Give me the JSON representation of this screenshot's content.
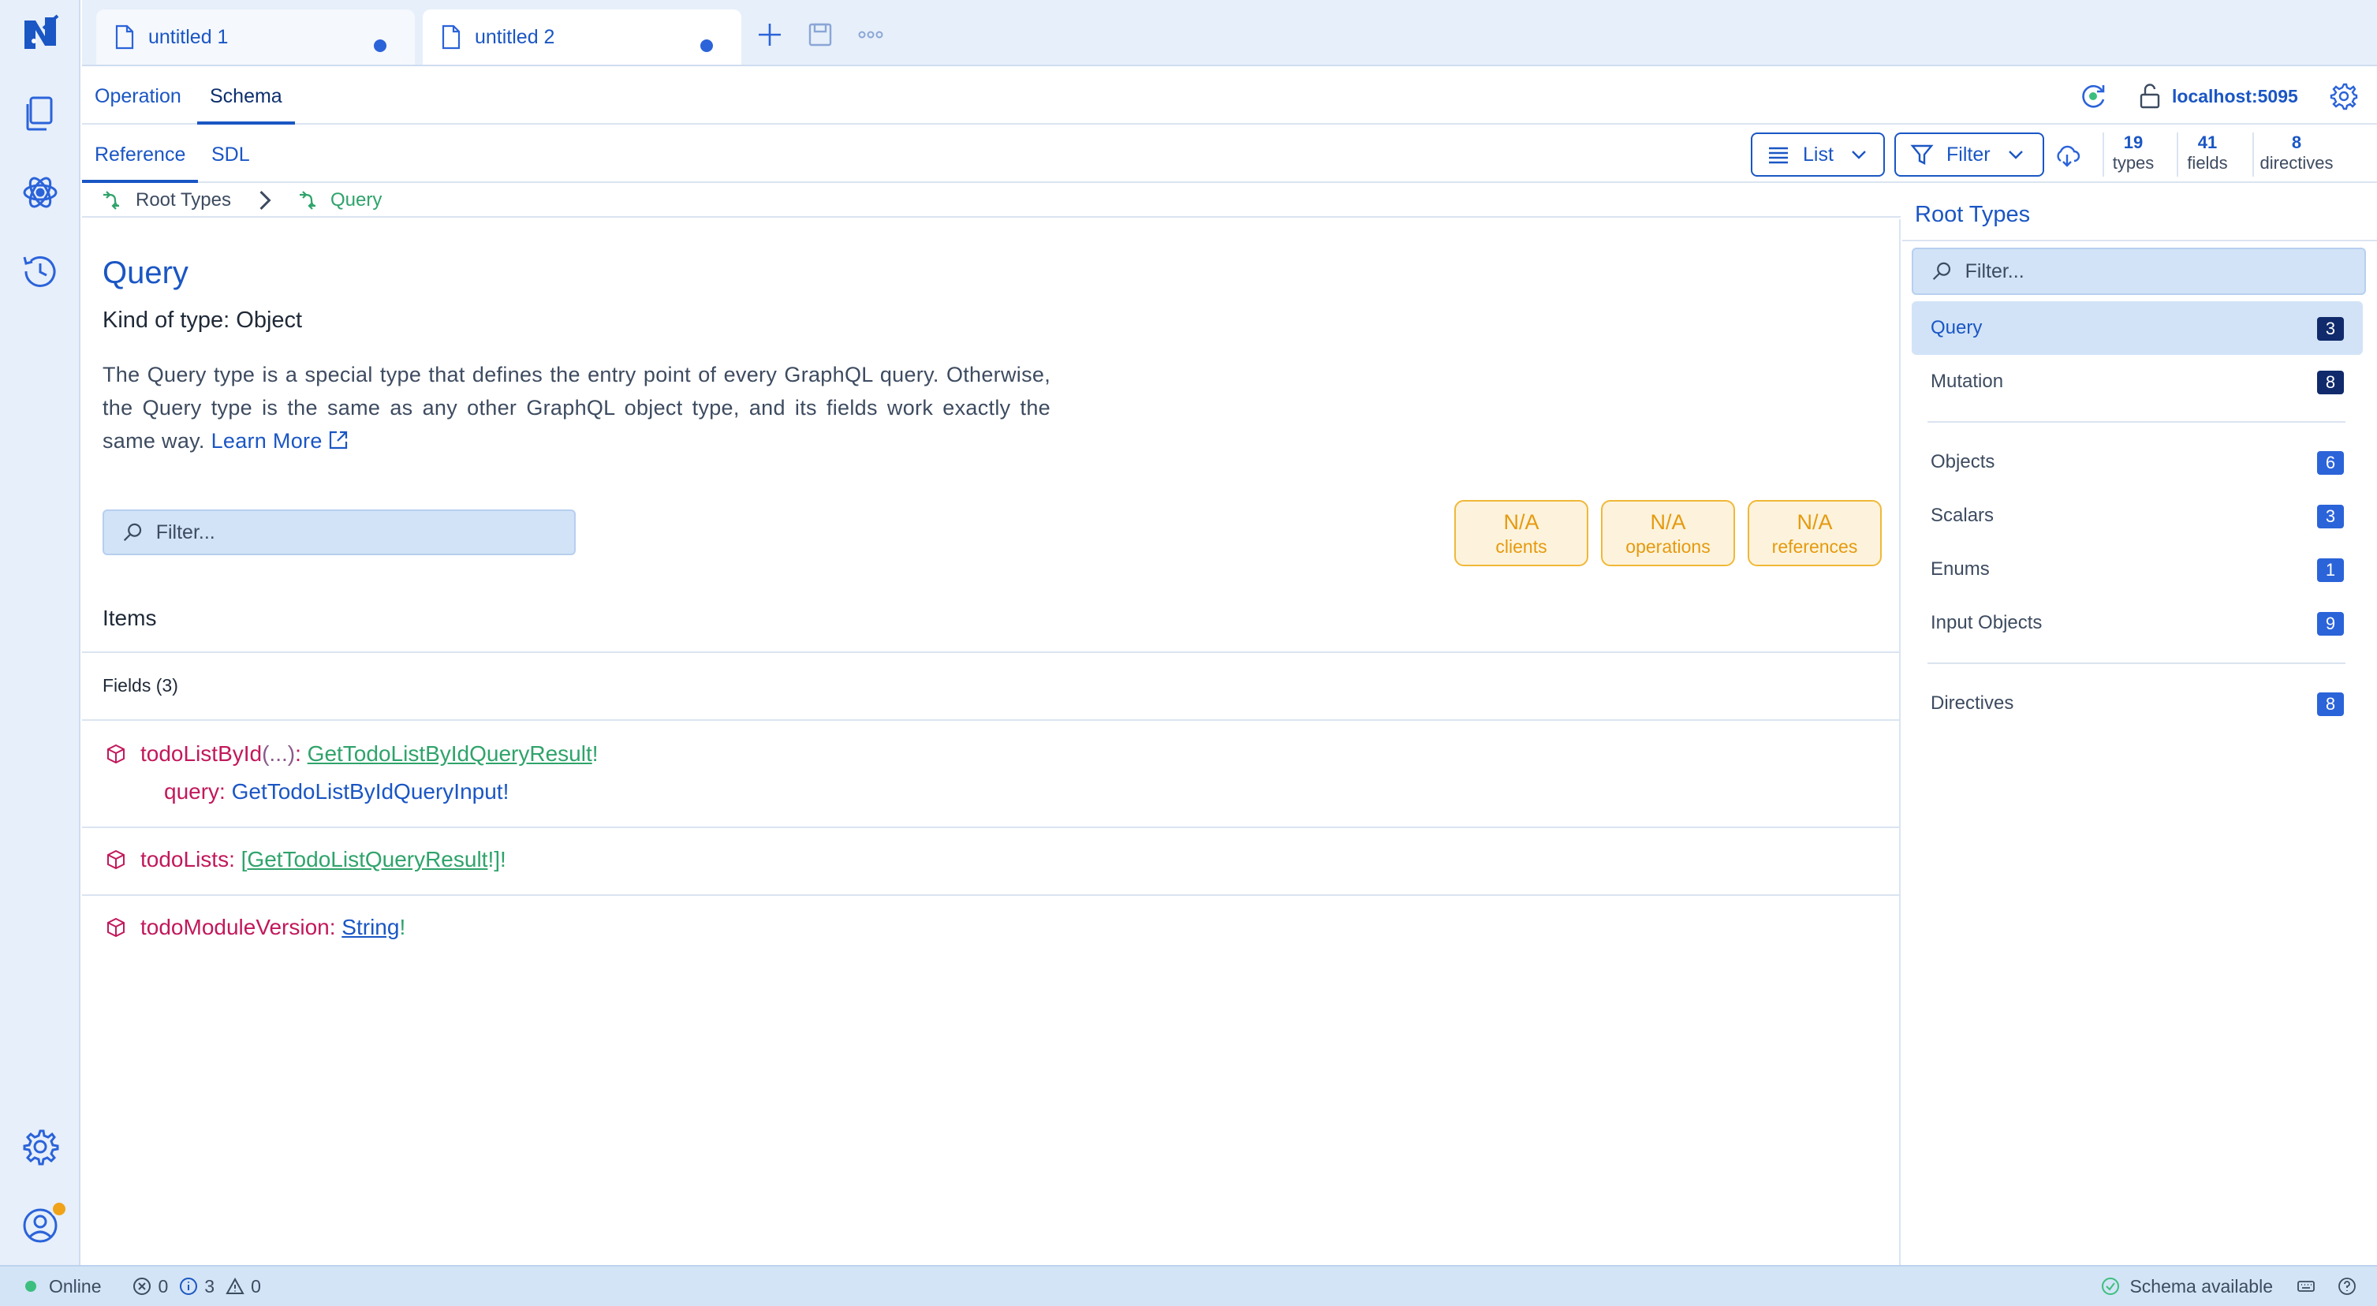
{
  "tabs": [
    {
      "label": "untitled 1",
      "modified": true,
      "active": false
    },
    {
      "label": "untitled 2",
      "modified": true,
      "active": true
    }
  ],
  "header": {
    "tabs": [
      "Operation",
      "Schema"
    ],
    "active_tab": "Schema",
    "connection": "localhost:5095"
  },
  "subbar": {
    "tabs": [
      "Reference",
      "SDL"
    ],
    "active_tab": "Reference",
    "list_label": "List",
    "filter_label": "Filter",
    "stats": [
      {
        "value": "19",
        "unit": "types"
      },
      {
        "value": "41",
        "unit": "fields"
      },
      {
        "value": "8",
        "unit": "directives"
      }
    ]
  },
  "breadcrumb": {
    "root": "Root Types",
    "current": "Query"
  },
  "type": {
    "name": "Query",
    "kind": "Kind of type: Object",
    "description": "The Query type is a special type that defines the entry point of every GraphQL query. Otherwise, the Query type is the same as any other GraphQL object type, and its fields work exactly the same way.",
    "learn_more": "Learn More",
    "filter_placeholder": "Filter..."
  },
  "badges": [
    {
      "value": "N/A",
      "label": "clients"
    },
    {
      "value": "N/A",
      "label": "operations"
    },
    {
      "value": "N/A",
      "label": "references"
    }
  ],
  "items": {
    "title": "Items",
    "fields_header": "Fields (3)",
    "fields": [
      {
        "name": "todoListById",
        "args": "(...)",
        "colon": ":",
        "type_prefix": "",
        "type": "GetTodoListByIdQueryResult",
        "type_suffix": "!",
        "arg_name": "query",
        "arg_colon": ":",
        "arg_type": "GetTodoListByIdQueryInput",
        "arg_suffix": "!"
      },
      {
        "name": "todoLists",
        "colon": ":",
        "type_prefix": "[",
        "type": "GetTodoListQueryResult",
        "type_suffix": "!]!"
      },
      {
        "name": "todoModuleVersion",
        "colon": ":",
        "type": "String",
        "type_suffix": "!"
      }
    ]
  },
  "sidebar": {
    "title": "Root Types",
    "filter_placeholder": "Filter...",
    "items": [
      {
        "label": "Query",
        "count": "3",
        "active": true
      },
      {
        "label": "Mutation",
        "count": "8"
      },
      {
        "label": "Objects",
        "count": "6"
      },
      {
        "label": "Scalars",
        "count": "3"
      },
      {
        "label": "Enums",
        "count": "1"
      },
      {
        "label": "Input Objects",
        "count": "9"
      },
      {
        "label": "Directives",
        "count": "8"
      }
    ]
  },
  "status": {
    "online": "Online",
    "errors": "0",
    "infos": "3",
    "warnings": "0",
    "schema": "Schema available"
  },
  "colors": {
    "accent": "#1a56c4",
    "field_name": "#c2185b",
    "type_link": "#2fa36b",
    "badge_border": "#f0b838",
    "status_online": "#3cbf7e",
    "avatar_badge": "#f0a318"
  },
  "icons": {
    "logo": "logo-icon",
    "files": "files-icon",
    "graph": "graph-icon",
    "history": "history-icon",
    "settings": "gear-icon",
    "account": "user-icon"
  }
}
